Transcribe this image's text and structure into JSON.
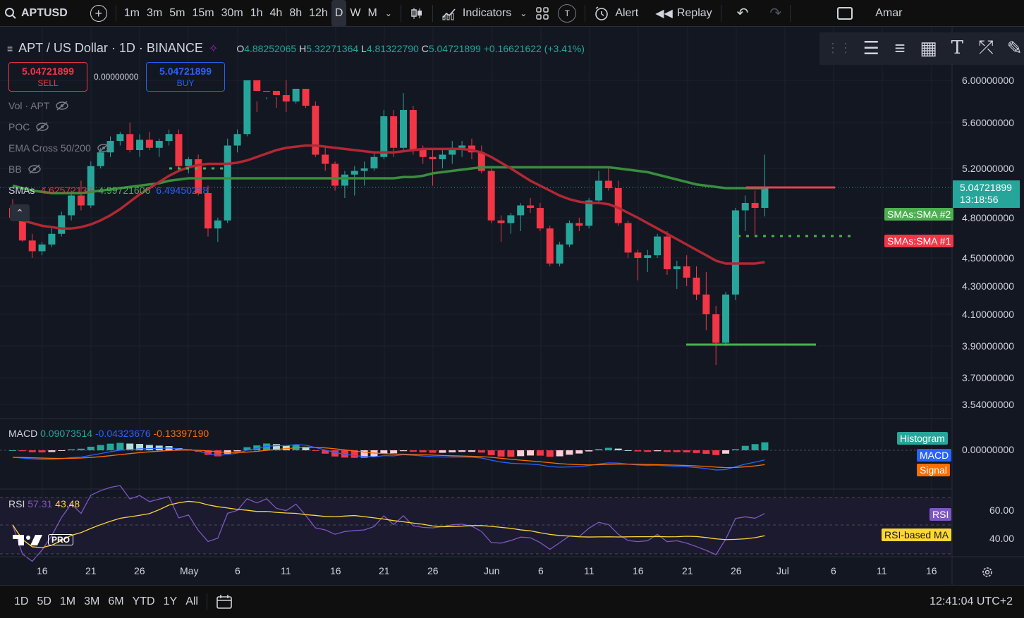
{
  "toolbar": {
    "symbol": "APTUSD",
    "timeframes": [
      "1m",
      "3m",
      "5m",
      "15m",
      "30m",
      "1h",
      "4h",
      "8h",
      "12h",
      "D",
      "W",
      "M"
    ],
    "active_timeframe": "D",
    "indicators_label": "Indicators",
    "t_badge": "T",
    "alert_label": "Alert",
    "replay_label": "Replay",
    "user_label": "Amar"
  },
  "legend": {
    "title": "APT / US Dollar · 1D · BINANCE",
    "open_key": "O",
    "open": "4.88252065",
    "high_key": "H",
    "high": "5.32271364",
    "low_key": "L",
    "low": "4.81322790",
    "close_key": "C",
    "close": "5.04721899",
    "change": "+0.16621622 (+3.41%)"
  },
  "trade": {
    "sell_price": "5.04721899",
    "sell_label": "SELL",
    "spread": "0.00000000",
    "buy_price": "5.04721899",
    "buy_label": "BUY"
  },
  "indicators": [
    {
      "name": "Vol · APT"
    },
    {
      "name": "POC"
    },
    {
      "name": "EMA Cross 50/200"
    },
    {
      "name": "BB"
    }
  ],
  "smas": {
    "label": "SMAs",
    "v1": "4.62572137",
    "v2": "4.99721606",
    "v3": "6.49450218"
  },
  "price_axis": [
    "6.00000000",
    "5.60000000",
    "5.20000000",
    "4.80000000",
    "4.50000000",
    "4.30000000",
    "4.10000000",
    "3.90000000",
    "3.70000000",
    "3.54000000"
  ],
  "last_price": {
    "value": "5.04721899",
    "countdown": "13:18:56"
  },
  "tags": {
    "sma2": "SMAs:SMA #2",
    "sma1": "SMAs:SMA #1",
    "histogram": "Histogram",
    "macd": "MACD",
    "signal": "Signal",
    "rsi": "RSI",
    "rsi_ma": "RSI-based MA"
  },
  "macd": {
    "label": "MACD",
    "v1": "0.09073514",
    "v2": "-0.04323676",
    "v3": "-0.13397190",
    "axis": "0.00000000"
  },
  "rsi": {
    "label": "RSI",
    "v1": "57.31",
    "v2": "43.48",
    "axis_high": "60.00",
    "axis_low": "40.00"
  },
  "watermark": "PRO",
  "time_axis": [
    "16",
    "21",
    "26",
    "May",
    "6",
    "11",
    "16",
    "21",
    "26",
    "Jun",
    "6",
    "11",
    "16",
    "21",
    "26",
    "Jul",
    "6",
    "11",
    "16"
  ],
  "ranges": [
    "1D",
    "5D",
    "1M",
    "3M",
    "6M",
    "YTD",
    "1Y",
    "All"
  ],
  "clock": "12:41:04 UTC+2",
  "colors": {
    "up": "#26a69a",
    "down": "#f23645",
    "bg": "#131722",
    "sma_green": "#388e3c",
    "sma_red": "#b22833",
    "macd": "#2962ff",
    "signal": "#ff6d00",
    "rsi": "#7e57c2",
    "rsi_ma": "#fdd835"
  },
  "chart_data": {
    "type": "candlestick",
    "candles": [
      [
        4.88,
        4.95,
        4.78,
        4.8
      ],
      [
        4.8,
        4.85,
        4.62,
        4.63
      ],
      [
        4.63,
        4.68,
        4.5,
        4.55
      ],
      [
        4.55,
        4.62,
        4.52,
        4.6
      ],
      [
        4.6,
        4.72,
        4.58,
        4.68
      ],
      [
        4.68,
        4.85,
        4.66,
        4.82
      ],
      [
        4.82,
        5.02,
        4.78,
        4.98
      ],
      [
        4.98,
        5.1,
        4.86,
        4.9
      ],
      [
        4.9,
        5.26,
        4.88,
        5.22
      ],
      [
        5.22,
        5.38,
        5.2,
        5.34
      ],
      [
        5.34,
        5.48,
        5.3,
        5.44
      ],
      [
        5.44,
        5.52,
        5.4,
        5.5
      ],
      [
        5.5,
        5.6,
        5.34,
        5.36
      ],
      [
        5.36,
        5.5,
        5.3,
        5.45
      ],
      [
        5.45,
        5.52,
        5.36,
        5.38
      ],
      [
        5.38,
        5.46,
        5.3,
        5.44
      ],
      [
        5.44,
        5.54,
        5.4,
        5.5
      ],
      [
        5.5,
        5.54,
        5.2,
        5.22
      ],
      [
        5.22,
        5.3,
        5.16,
        5.28
      ],
      [
        5.28,
        5.32,
        4.98,
        5.0
      ],
      [
        5.0,
        5.06,
        4.66,
        4.72
      ],
      [
        4.72,
        4.8,
        4.62,
        4.78
      ],
      [
        4.78,
        5.46,
        4.76,
        5.4
      ],
      [
        5.4,
        5.54,
        5.34,
        5.5
      ],
      [
        5.5,
        6.08,
        5.48,
        6.0
      ],
      [
        6.0,
        6.3,
        5.8,
        5.9
      ],
      [
        5.9,
        6.18,
        5.84,
        6.1
      ],
      [
        6.1,
        6.26,
        5.84,
        5.86
      ],
      [
        5.86,
        6.0,
        5.7,
        5.8
      ],
      [
        5.8,
        6.12,
        5.78,
        6.08
      ],
      [
        6.08,
        6.14,
        5.74,
        5.76
      ],
      [
        5.76,
        5.8,
        5.3,
        5.32
      ],
      [
        5.32,
        5.38,
        5.18,
        5.24
      ],
      [
        5.24,
        5.26,
        5.02,
        5.06
      ],
      [
        5.06,
        5.18,
        4.96,
        5.15
      ],
      [
        5.15,
        5.22,
        4.98,
        5.18
      ],
      [
        5.18,
        5.26,
        5.06,
        5.2
      ],
      [
        5.2,
        5.34,
        5.18,
        5.3
      ],
      [
        5.3,
        5.72,
        5.28,
        5.66
      ],
      [
        5.66,
        5.72,
        5.3,
        5.38
      ],
      [
        5.38,
        5.88,
        5.34,
        5.72
      ],
      [
        5.72,
        5.76,
        5.32,
        5.36
      ],
      [
        5.36,
        5.4,
        5.24,
        5.3
      ],
      [
        5.3,
        5.36,
        5.06,
        5.28
      ],
      [
        5.28,
        5.36,
        5.2,
        5.32
      ],
      [
        5.32,
        5.44,
        5.24,
        5.38
      ],
      [
        5.38,
        5.44,
        5.3,
        5.4
      ],
      [
        5.4,
        5.46,
        5.28,
        5.34
      ],
      [
        5.34,
        5.4,
        5.16,
        5.18
      ],
      [
        5.18,
        5.22,
        4.76,
        4.78
      ],
      [
        4.78,
        4.82,
        4.62,
        4.76
      ],
      [
        4.76,
        4.84,
        4.68,
        4.82
      ],
      [
        4.82,
        4.92,
        4.7,
        4.9
      ],
      [
        4.9,
        4.96,
        4.84,
        4.88
      ],
      [
        4.88,
        4.92,
        4.7,
        4.72
      ],
      [
        4.72,
        4.74,
        4.44,
        4.46
      ],
      [
        4.46,
        4.62,
        4.44,
        4.6
      ],
      [
        4.6,
        4.78,
        4.58,
        4.76
      ],
      [
        4.76,
        4.8,
        4.7,
        4.74
      ],
      [
        4.74,
        4.96,
        4.72,
        4.94
      ],
      [
        4.94,
        5.18,
        4.92,
        5.1
      ],
      [
        5.1,
        5.2,
        5.02,
        5.04
      ],
      [
        5.04,
        5.1,
        4.74,
        4.76
      ],
      [
        4.76,
        4.78,
        4.5,
        4.54
      ],
      [
        4.54,
        4.56,
        4.34,
        4.5
      ],
      [
        4.5,
        4.56,
        4.4,
        4.52
      ],
      [
        4.52,
        4.68,
        4.5,
        4.66
      ],
      [
        4.66,
        4.7,
        4.38,
        4.42
      ],
      [
        4.42,
        4.48,
        4.28,
        4.44
      ],
      [
        4.44,
        4.52,
        4.3,
        4.36
      ],
      [
        4.36,
        4.44,
        4.2,
        4.24
      ],
      [
        4.24,
        4.4,
        4.0,
        4.1
      ],
      [
        4.1,
        4.16,
        3.78,
        3.92
      ],
      [
        3.92,
        4.26,
        3.9,
        4.24
      ],
      [
        4.24,
        4.88,
        4.2,
        4.86
      ],
      [
        4.86,
        4.98,
        4.7,
        4.92
      ],
      [
        4.92,
        5.02,
        4.66,
        4.88
      ],
      [
        4.88,
        5.32,
        4.81,
        5.05
      ]
    ],
    "sma_green": [
      5.06,
      5.04,
      5.02,
      5.01,
      5.0,
      5.0,
      5.0,
      5.0,
      5.01,
      5.02,
      5.03,
      5.04,
      5.05,
      5.06,
      5.07,
      5.08,
      5.1,
      5.11,
      5.12,
      5.12,
      5.12,
      5.12,
      5.12,
      5.12,
      5.12,
      5.12,
      5.12,
      5.12,
      5.12,
      5.12,
      5.12,
      5.12,
      5.12,
      5.12,
      5.12,
      5.12,
      5.12,
      5.12,
      5.12,
      5.12,
      5.13,
      5.13,
      5.14,
      5.16,
      5.17,
      5.18,
      5.19,
      5.2,
      5.21,
      5.21,
      5.21,
      5.21,
      5.21,
      5.21,
      5.21,
      5.21,
      5.21,
      5.21,
      5.21,
      5.21,
      5.21,
      5.21,
      5.2,
      5.19,
      5.18,
      5.17,
      5.15,
      5.13,
      5.11,
      5.09,
      5.07,
      5.06,
      5.05,
      5.04,
      5.04,
      5.04,
      5.04,
      5.04
    ],
    "sma_red": [
      4.8,
      4.78,
      4.76,
      4.74,
      4.73,
      4.72,
      4.72,
      4.73,
      4.75,
      4.78,
      4.82,
      4.87,
      4.93,
      4.99,
      5.04,
      5.09,
      5.14,
      5.18,
      5.21,
      5.23,
      5.24,
      5.24,
      5.24,
      5.25,
      5.27,
      5.3,
      5.33,
      5.36,
      5.38,
      5.39,
      5.4,
      5.4,
      5.39,
      5.38,
      5.37,
      5.36,
      5.35,
      5.34,
      5.34,
      5.34,
      5.35,
      5.36,
      5.37,
      5.37,
      5.37,
      5.37,
      5.37,
      5.36,
      5.34,
      5.3,
      5.25,
      5.2,
      5.15,
      5.1,
      5.06,
      5.02,
      4.98,
      4.95,
      4.93,
      4.92,
      4.92,
      4.91,
      4.88,
      4.84,
      4.8,
      4.76,
      4.72,
      4.68,
      4.64,
      4.6,
      4.56,
      4.52,
      4.48,
      4.46,
      4.46,
      4.46,
      4.46,
      4.47
    ],
    "ylim": [
      3.54,
      6.25
    ]
  }
}
